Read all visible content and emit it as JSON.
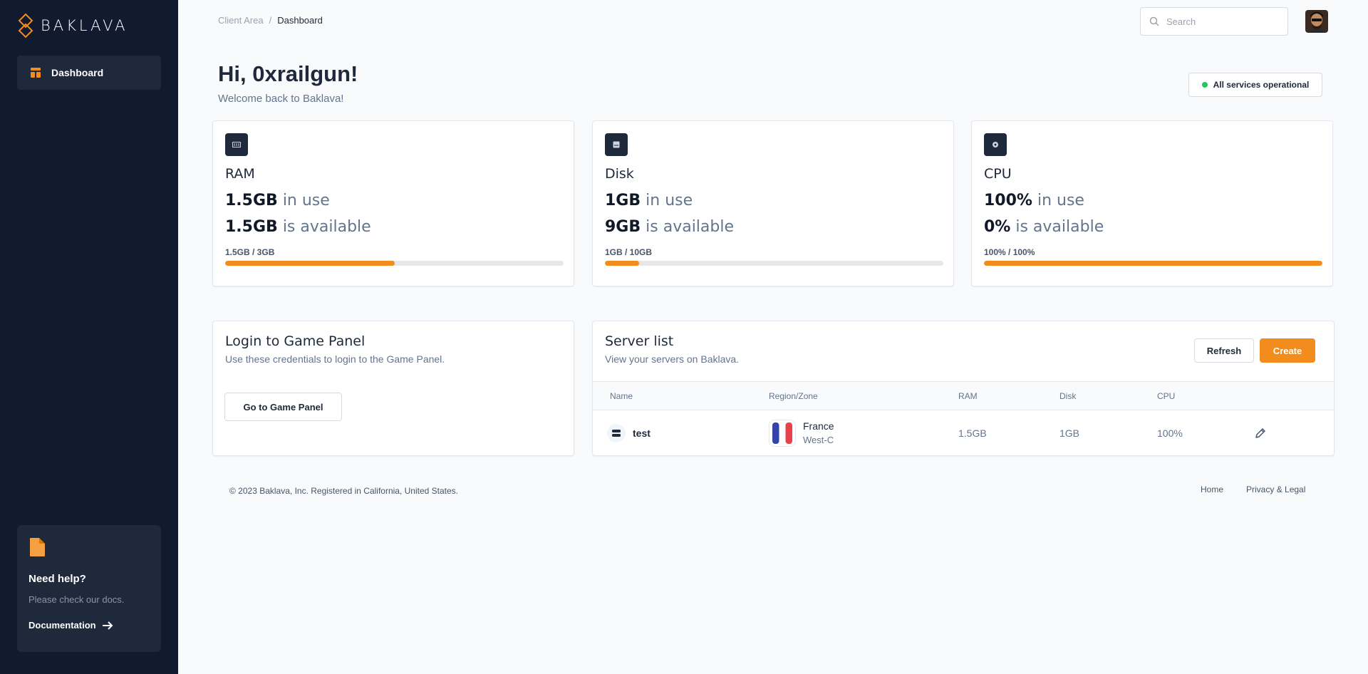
{
  "brand": {
    "name": "BAKLAVA",
    "accent": "#f28c1c"
  },
  "sidebar": {
    "items": [
      {
        "label": "Dashboard",
        "icon": "dashboard-icon"
      }
    ],
    "help": {
      "title": "Need help?",
      "text": "Please check our docs.",
      "link": "Documentation"
    }
  },
  "header": {
    "breadcrumb": {
      "parent": "Client Area",
      "separator": "/",
      "current": "Dashboard"
    },
    "search": {
      "placeholder": "Search",
      "value": ""
    }
  },
  "greeting": {
    "title": "Hi, 0xrailgun!",
    "subtitle": "Welcome back to Baklava!"
  },
  "status": {
    "text": "All services operational",
    "color": "#22c55e"
  },
  "stats": [
    {
      "title": "RAM",
      "used": "1.5GB",
      "used_suffix": "in use",
      "available": "1.5GB",
      "available_suffix": "is available",
      "ratio": "1.5GB / 3GB",
      "fill": 0.5
    },
    {
      "title": "Disk",
      "used": "1GB",
      "used_suffix": "in use",
      "available": "9GB",
      "available_suffix": "is available",
      "ratio": "1GB / 10GB",
      "fill": 0.1
    },
    {
      "title": "CPU",
      "used": "100%",
      "used_suffix": "in use",
      "available": "0%",
      "available_suffix": "is available",
      "ratio": "100% / 100%",
      "fill": 1.0
    }
  ],
  "game_panel": {
    "title": "Login to Game Panel",
    "subtitle": "Use these credentials to login to the Game Panel.",
    "button": "Go to Game Panel"
  },
  "servers": {
    "title": "Server list",
    "subtitle": "View your servers on Baklava.",
    "refresh": "Refresh",
    "create": "Create",
    "columns": [
      "Name",
      "Region/Zone",
      "RAM",
      "Disk",
      "CPU"
    ],
    "rows": [
      {
        "name": "test",
        "country": "France",
        "zone": "West-C",
        "ram": "1.5GB",
        "disk": "1GB",
        "cpu": "100%"
      }
    ]
  },
  "footer": {
    "copyright": "© 2023 Baklava, Inc. Registered in California, United States.",
    "links": [
      "Home",
      "Privacy & Legal"
    ]
  }
}
